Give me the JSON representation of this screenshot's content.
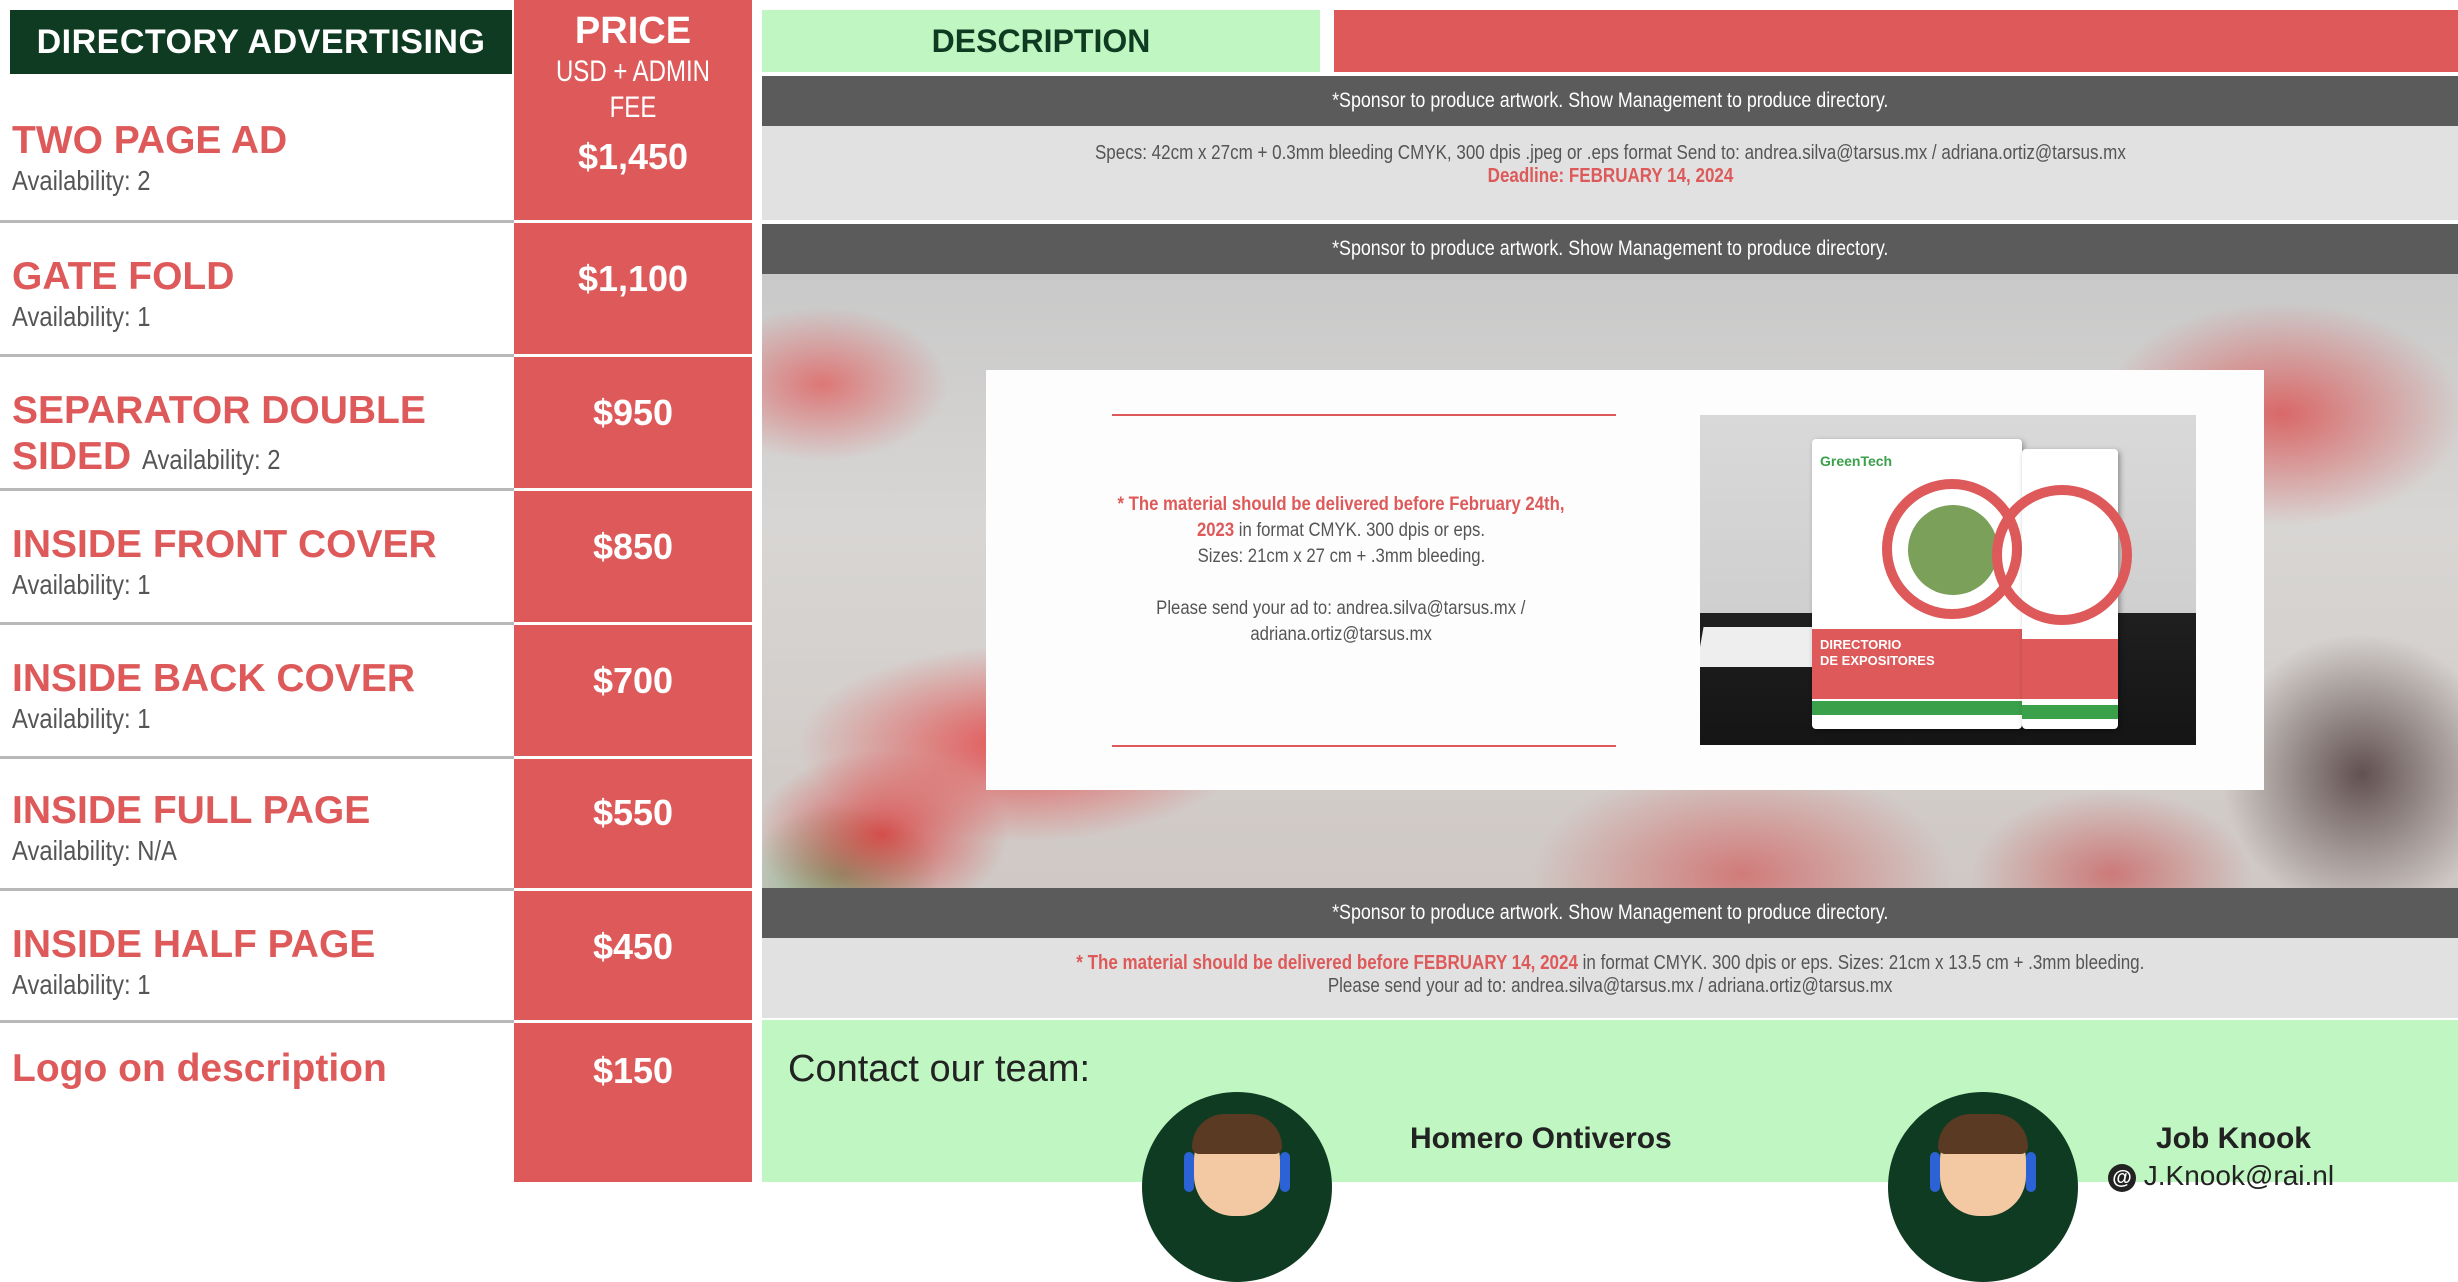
{
  "header": {
    "directory_title": "DIRECTORY ADVERTISING",
    "price_title": "PRICE",
    "price_subtitle": "USD + ADMIN FEE",
    "description_title": "DESCRIPTION"
  },
  "items": [
    {
      "name": "TWO PAGE AD",
      "availability": "Availability: 2",
      "price": "$1,450"
    },
    {
      "name": "GATE FOLD",
      "availability": "Availability: 1",
      "price": "$1,100"
    },
    {
      "name": "SEPARATOR DOUBLE",
      "name_line2": "SIDED",
      "availability": "Availability: 2",
      "price": "$950"
    },
    {
      "name": "INSIDE FRONT COVER",
      "availability": "Availability: 1",
      "price": "$850"
    },
    {
      "name": "INSIDE BACK COVER",
      "availability": "Availability: 1",
      "price": "$700"
    },
    {
      "name": "INSIDE FULL PAGE",
      "availability": "Availability: N/A",
      "price": "$550"
    },
    {
      "name": "INSIDE HALF PAGE",
      "availability": "Availability: 1",
      "price": "$450"
    },
    {
      "name": "Logo on description",
      "availability": "",
      "price": "$150"
    }
  ],
  "descriptions": {
    "sponsor_note": "*Sponsor to produce artwork. Show Management to produce directory.",
    "two_page_specs": "Specs: 42cm x 27cm + 0.3mm bleeding CMYK, 300 dpis .jpeg or .eps format Send to: andrea.silva@tarsus.mx / adriana.ortiz@tarsus.mx",
    "two_page_deadline": "Deadline: FEBRUARY 14, 2024",
    "card_highlight": "* The material should be delivered before February 24th, 2023",
    "card_format": " in format CMYK. 300 dpis or eps.",
    "card_sizes": "Sizes: 21cm x 27 cm + .3mm bleeding.",
    "card_send": "Please send your ad to: andrea.silva@tarsus.mx /",
    "card_send2": "adriana.ortiz@tarsus.mx",
    "half_highlight": "* The material should be delivered before FEBRUARY 14, 2024",
    "half_rest": " in format CMYK. 300 dpis or eps. Sizes: 21cm x 13.5 cm + .3mm bleeding.",
    "half_send": "Please send your ad to: andrea.silva@tarsus.mx  / adriana.ortiz@tarsus.mx"
  },
  "magazine": {
    "brand": "GreenTech",
    "title_line1": "DIRECTORIO",
    "title_line2": "DE EXPOSITORES"
  },
  "contact": {
    "title": "Contact our team:",
    "people": [
      {
        "name": "Homero Ontiveros",
        "email": ""
      },
      {
        "name": "Job Knook",
        "email": "J.Knook@rai.nl"
      }
    ]
  },
  "colors": {
    "red": "#de5a5a",
    "dark_green": "#0f3b22",
    "light_green": "#bff6c1",
    "gray_bar": "#5b5b5b",
    "light_gray": "#e1e1e1"
  }
}
